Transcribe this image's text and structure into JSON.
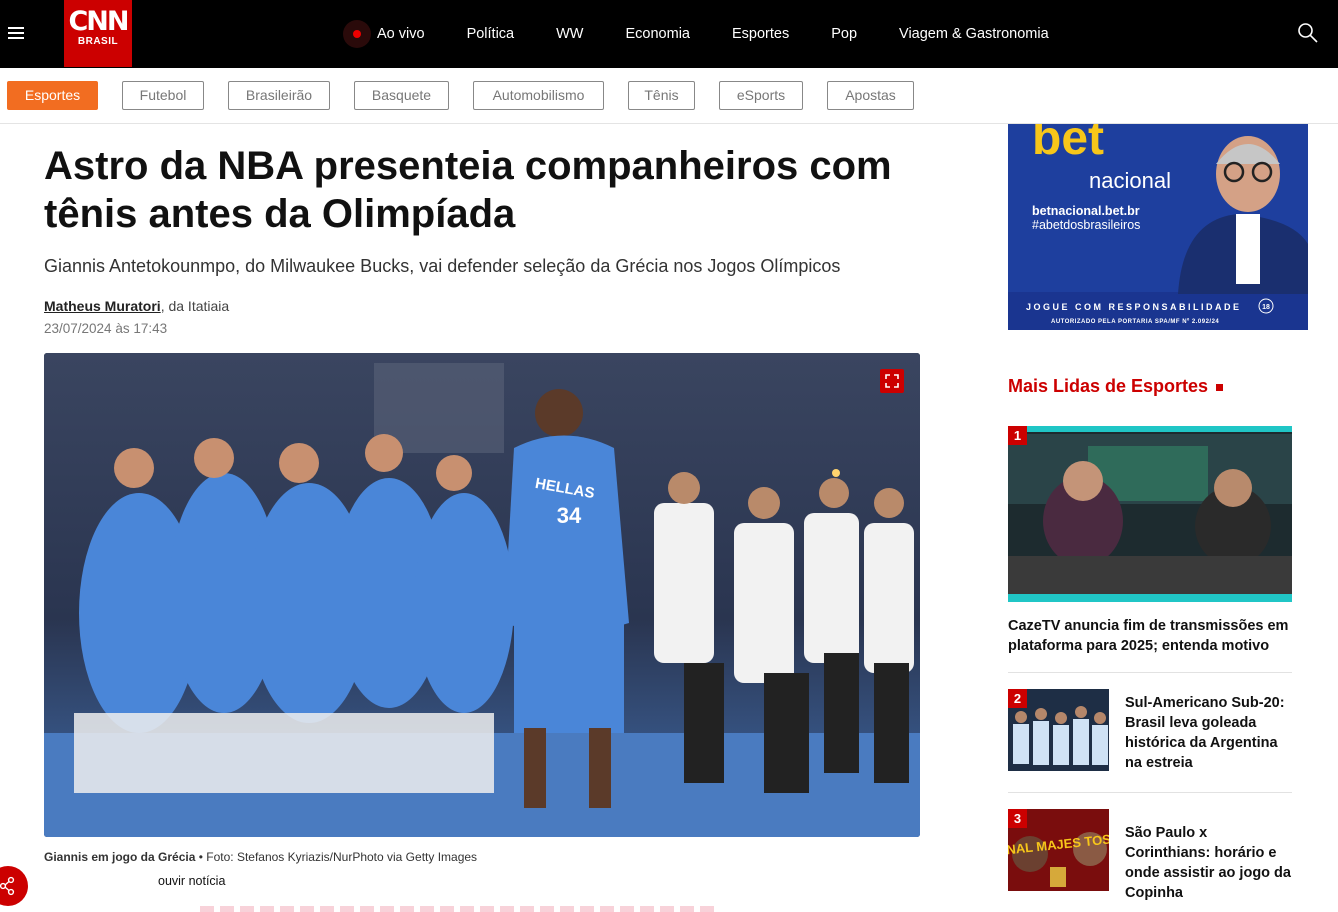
{
  "header": {
    "logo_text": "CNN",
    "logo_sub": "BRASIL",
    "nav": [
      {
        "label": "Ao vivo"
      },
      {
        "label": "Política"
      },
      {
        "label": "WW"
      },
      {
        "label": "Economia"
      },
      {
        "label": "Esportes"
      },
      {
        "label": "Pop"
      },
      {
        "label": "Viagem & Gastronomia"
      }
    ]
  },
  "subnav": {
    "chips": [
      {
        "label": "Esportes",
        "active": true
      },
      {
        "label": "Futebol"
      },
      {
        "label": "Brasileirão"
      },
      {
        "label": "Basquete"
      },
      {
        "label": "Automobilismo"
      },
      {
        "label": "Tênis"
      },
      {
        "label": "eSports"
      },
      {
        "label": "Apostas"
      }
    ]
  },
  "article": {
    "title": "Astro da NBA presenteia companheiros com tênis antes da Olimpíada",
    "lead": "Giannis Antetokounmpo, do Milwaukee Bucks, vai defender seleção da Grécia nos Jogos Olímpicos",
    "author": "Matheus Muratori",
    "author_suffix": ", da Itatiaia",
    "date": "23/07/2024 às 17:43",
    "caption_bold": "Giannis em jogo da Grécia",
    "caption_rest": " • Foto: Stefanos Kyriazis/NurPhoto via Getty Images",
    "listen_label": "ouvir notícia",
    "photo_jersey_text": "HELLAS",
    "photo_jersey_number": "34"
  },
  "ad": {
    "brand_top": "bet",
    "brand_bottom": "nacional",
    "url": "betnacional.bet.br",
    "hashtag": "#abetdosbrasileiros",
    "footer1": "JOGUE COM RESPONSABILIDADE",
    "footer_age": "18",
    "footer2": "AUTORIZADO PELA PORTARIA SPA/MF Nº 2.092/24"
  },
  "most_read": {
    "heading": "Mais Lidas de Esportes",
    "items": [
      {
        "rank": "1",
        "title": "CazeTV anuncia fim de transmissões em plataforma para 2025; entenda motivo"
      },
      {
        "rank": "2",
        "title": "Sul-Americano Sub-20: Brasil leva goleada histórica da Argentina na estreia"
      },
      {
        "rank": "3",
        "title": "São Paulo x Corinthians: horário e onde assistir ao jogo da Copinha",
        "thumb_text": "FINAL MAJES TOSA"
      }
    ]
  },
  "colors": {
    "brand_red": "#cc0000",
    "active_chip": "#f26d21",
    "ad_blue": "#1e3f9e",
    "ad_yellow": "#f7c61a"
  }
}
